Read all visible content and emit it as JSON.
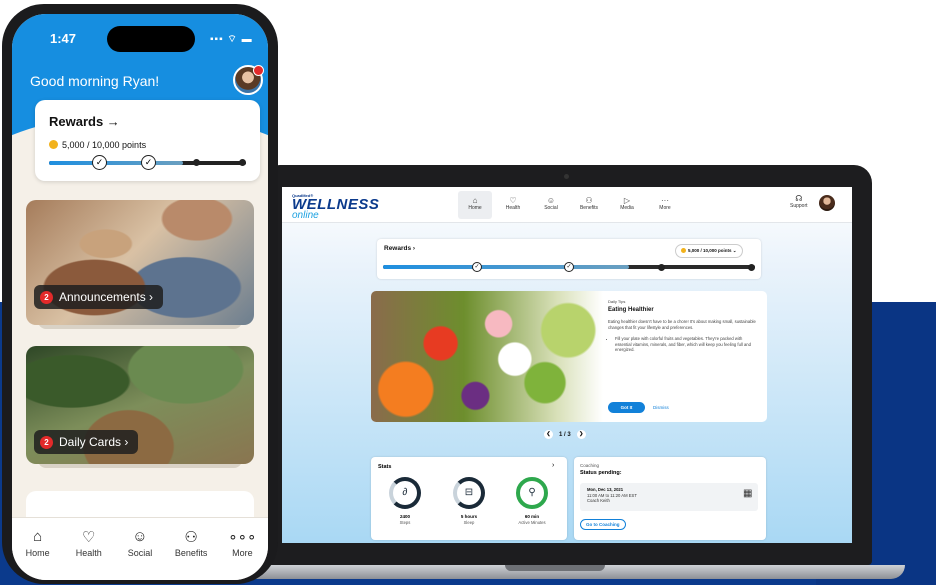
{
  "phone": {
    "time": "1:47",
    "status": "▪▪▪ ⌔ ▬",
    "greeting": "Good morning Ryan!",
    "rewards_title": "Rewards →",
    "points": "5,000 / 10,000 points",
    "cards": [
      {
        "badge": "2",
        "label": "Announcements ›"
      },
      {
        "badge": "2",
        "label": "Daily Cards ›"
      }
    ],
    "tabs": [
      {
        "icon": "home-icon",
        "glyph": "⌂",
        "label": "Home"
      },
      {
        "icon": "heart-icon",
        "glyph": "♡",
        "label": "Health"
      },
      {
        "icon": "people-icon",
        "glyph": "☺",
        "label": "Social"
      },
      {
        "icon": "benefits-icon",
        "glyph": "⚇",
        "label": "Benefits"
      },
      {
        "icon": "more-icon",
        "glyph": "∘∘∘",
        "label": "More"
      }
    ]
  },
  "laptop": {
    "logo": {
      "small": "QuadMed®",
      "big": "WELLNESS",
      "script": "online"
    },
    "nav": [
      {
        "glyph": "⌂",
        "label": "Home"
      },
      {
        "glyph": "♡",
        "label": "Health"
      },
      {
        "glyph": "☺",
        "label": "Social"
      },
      {
        "glyph": "⚇",
        "label": "Benefits"
      },
      {
        "glyph": "▷",
        "label": "Media"
      },
      {
        "glyph": "···",
        "label": "More"
      }
    ],
    "support": "Support",
    "rewards": {
      "title": "Rewards ›",
      "points": "5,000 / 10,000 points ⌄"
    },
    "tip": {
      "label": "Daily Tips",
      "title": "Eating Healthier",
      "body": "Eating healthier doesn't have to be a chore! It's about making small, sustainable changes that fit your lifestyle and preferences.",
      "bullet": "Fill your plate with colorful fruits and vegetables. They're packed with essential vitamins, minerals, and fiber, which will keep you feeling full and energized.",
      "primary": "Got It",
      "secondary": "Dismiss"
    },
    "pager": "1 / 3",
    "stats": {
      "title": "Stats",
      "items": [
        {
          "value": "2400",
          "label": "Steps",
          "glyph": "∂"
        },
        {
          "value": "5 hours",
          "label": "Sleep",
          "glyph": "⊟"
        },
        {
          "value": "60 min",
          "label": "Active Minutes",
          "glyph": "⚲"
        }
      ]
    },
    "coaching": {
      "label": "Coaching",
      "title": "Status pending:",
      "date": "Mon, Dec 13, 2021",
      "time": "11:00 AM to 11:20 AM EST",
      "coach": "Coach Keith",
      "button": "Go to Coaching"
    }
  },
  "progress": {
    "laptop_fill": 0.66,
    "phone_fill": 0.68
  }
}
